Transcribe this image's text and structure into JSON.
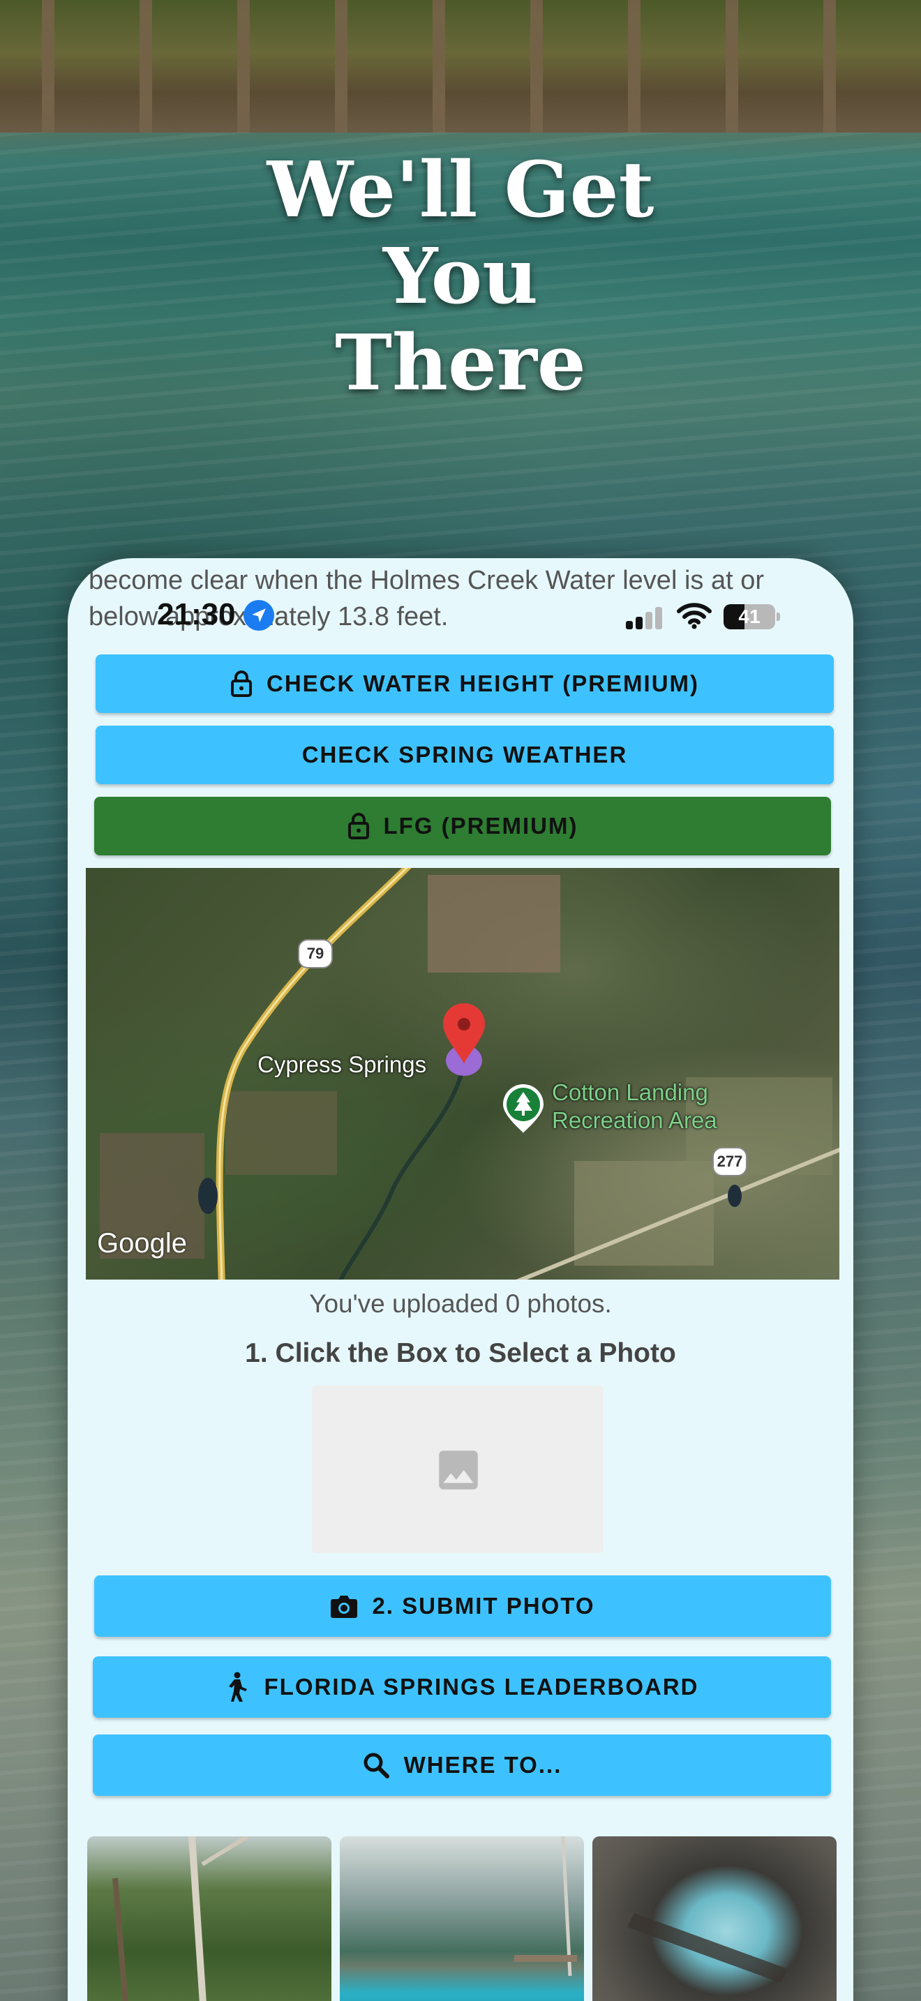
{
  "headline": {
    "line1": "We'll Get",
    "line2": "You",
    "line3": "There"
  },
  "behind_text": "become clear when the Holmes Creek Water level is at or below approximately 13.8 feet.",
  "status_bar": {
    "time": "21:30",
    "battery_level": "41",
    "battery_fraction": 0.41,
    "location_icon": "location-arrow-icon",
    "signal_icon": "cellular-signal-icon",
    "wifi_icon": "wifi-icon"
  },
  "buttons": {
    "check_water": {
      "label": "CHECK WATER HEIGHT (PREMIUM)",
      "icon": "lock-icon"
    },
    "check_weather": {
      "label": "CHECK SPRING WEATHER"
    },
    "lfg": {
      "label": "LFG (PREMIUM)",
      "icon": "lock-icon"
    },
    "submit_photo": {
      "label": "2. SUBMIT PHOTO",
      "icon": "camera-icon"
    },
    "leaderboard": {
      "label": "FLORIDA SPRINGS LEADERBOARD",
      "icon": "person-hiking-icon"
    },
    "where_to": {
      "label": "WHERE TO...",
      "icon": "search-icon"
    }
  },
  "map": {
    "pin_label": "Cypress Springs",
    "poi_line1": "Cotton Landing",
    "poi_line2": "Recreation Area",
    "route_79": "79",
    "route_277": "277",
    "provider": "Google"
  },
  "uploads_text": "You've uploaded 0 photos.",
  "select_photo_title": "1. Click the Box to Select a Photo",
  "colors": {
    "accent_blue": "#3ec2ff",
    "accent_green": "#2e7d32",
    "panel_bg": "#e6f8fc"
  }
}
